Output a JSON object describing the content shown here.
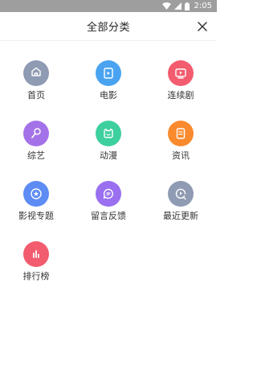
{
  "status_bar": {
    "time": "2:05"
  },
  "header": {
    "title": "全部分类"
  },
  "categories": [
    {
      "label": "首页",
      "icon": "home-icon",
      "color": "#8f9bb3"
    },
    {
      "label": "电影",
      "icon": "movie-icon",
      "color": "#4aa3f0"
    },
    {
      "label": "连续剧",
      "icon": "tv-series-icon",
      "color": "#f25c6e"
    },
    {
      "label": "综艺",
      "icon": "microphone-icon",
      "color": "#a472e8"
    },
    {
      "label": "动漫",
      "icon": "anime-face-icon",
      "color": "#3ecf9e"
    },
    {
      "label": "资讯",
      "icon": "news-icon",
      "color": "#f98a2e"
    },
    {
      "label": "影视专题",
      "icon": "topic-star-icon",
      "color": "#5d8cf4"
    },
    {
      "label": "留言反馈",
      "icon": "feedback-chat-icon",
      "color": "#9a6ff0"
    },
    {
      "label": "最近更新",
      "icon": "recent-play-icon",
      "color": "#8f9bb3"
    },
    {
      "label": "排行榜",
      "icon": "ranking-bars-icon",
      "color": "#f25c6e"
    }
  ]
}
